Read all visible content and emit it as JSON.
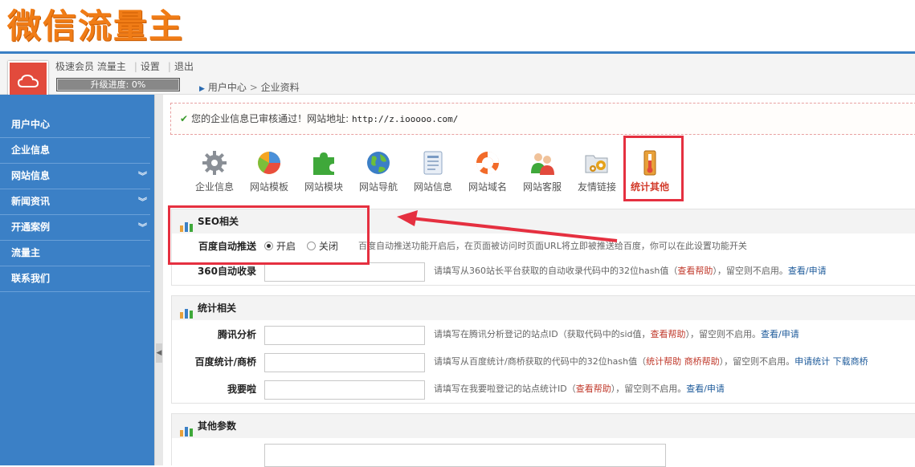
{
  "header": {
    "logo": "微信流量主"
  },
  "user": {
    "member": "极速会员 流量主",
    "settings": "设置",
    "logout": "退出",
    "progress": "升级进度: 0%",
    "progress_value": 0
  },
  "breadcrumb": {
    "item1": "用户中心",
    "item2": "企业资料"
  },
  "sidebar": {
    "items": [
      {
        "label": "用户中心"
      },
      {
        "label": "企业信息"
      },
      {
        "label": "网站信息"
      },
      {
        "label": "新闻资讯"
      },
      {
        "label": "开通案例"
      },
      {
        "label": "流量主"
      },
      {
        "label": "联系我们"
      }
    ]
  },
  "notice": {
    "text": "您的企业信息已审核通过！网站地址:",
    "url": "http://z.iooooo.com/"
  },
  "tools": [
    {
      "label": "企业信息",
      "icon": "gear-icon"
    },
    {
      "label": "网站模板",
      "icon": "pie-chart-icon"
    },
    {
      "label": "网站模块",
      "icon": "puzzle-icon"
    },
    {
      "label": "网站导航",
      "icon": "globe-icon"
    },
    {
      "label": "网站信息",
      "icon": "document-icon"
    },
    {
      "label": "网站域名",
      "icon": "lifebuoy-icon"
    },
    {
      "label": "网站客服",
      "icon": "people-icon"
    },
    {
      "label": "友情链接",
      "icon": "folder-gear-icon"
    },
    {
      "label": "统计其他",
      "icon": "thermometer-icon"
    }
  ],
  "seo": {
    "title": "SEO相关",
    "baidu_label": "百度自动推送",
    "on": "开启",
    "off": "关闭",
    "baidu_hint": "百度自动推送功能开启后，在页面被访问时页面URL将立即被推送给百度，你可以在此设置功能开关",
    "s360_label": "360自动收录",
    "s360_hint_a": "请填写从360站长平台获取的自动收录代码中的32位hash值（",
    "s360_help": "查看帮助",
    "s360_hint_b": "），留空则不启用。",
    "s360_link": "查看/申请"
  },
  "stats": {
    "title": "统计相关",
    "tencent_label": "腾讯分析",
    "tencent_hint_a": "请填写在腾讯分析登记的站点ID（获取代码中的sid值，",
    "tencent_help": "查看帮助",
    "tencent_hint_b": "），留空则不启用。",
    "tencent_link": "查看/申请",
    "baidu_label": "百度统计/商桥",
    "baidu_hint_a": "请填写从百度统计/商桥获取的代码中的32位hash值（",
    "baidu_help1": "统计帮助",
    "baidu_help2": "商桥帮助",
    "baidu_hint_b": "），留空则不启用。",
    "baidu_link1": "申请统计",
    "baidu_link2": "下载商桥",
    "wyl_label": "我要啦",
    "wyl_hint_a": "请填写在我要啦登记的站点统计ID（",
    "wyl_help": "查看帮助",
    "wyl_hint_b": "），留空则不启用。",
    "wyl_link": "查看/申请"
  },
  "other": {
    "title": "其他参数"
  },
  "colors": {
    "sidebar": "#3b80c6",
    "logo": "#f07c16",
    "highlight": "#e53040"
  }
}
